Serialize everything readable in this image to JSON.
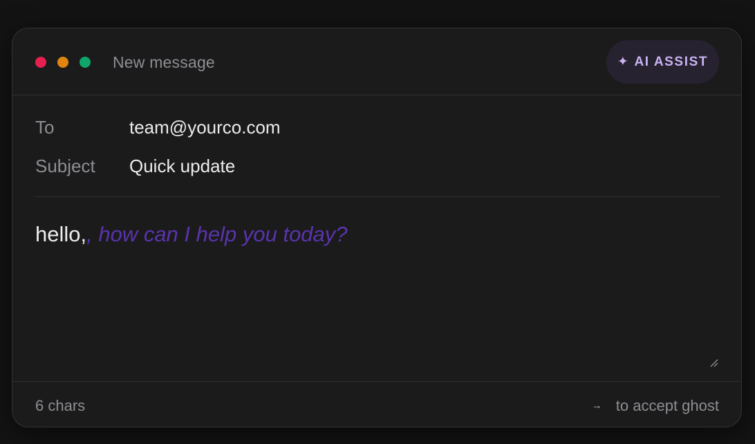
{
  "window": {
    "title": "New message",
    "traffic_lights": [
      "red",
      "amber",
      "green"
    ]
  },
  "ai_assist": {
    "icon": "sparkle-icon",
    "label": "AI ASSIST"
  },
  "fields": {
    "to": {
      "label": "To",
      "value": "team@yourco.com"
    },
    "subject": {
      "label": "Subject",
      "value": "Quick update"
    }
  },
  "body": {
    "typed_text": "hello,",
    "ghost_text": ", how can I help you today?"
  },
  "footer": {
    "char_count": "6 chars",
    "accept_key": "→",
    "accept_hint": "to accept ghost"
  },
  "colors": {
    "close": "#e5204f",
    "minimize": "#e0860f",
    "maximize": "#10a56a",
    "ghost_text": "#5a33ad",
    "accent": "#c9b3f2"
  }
}
